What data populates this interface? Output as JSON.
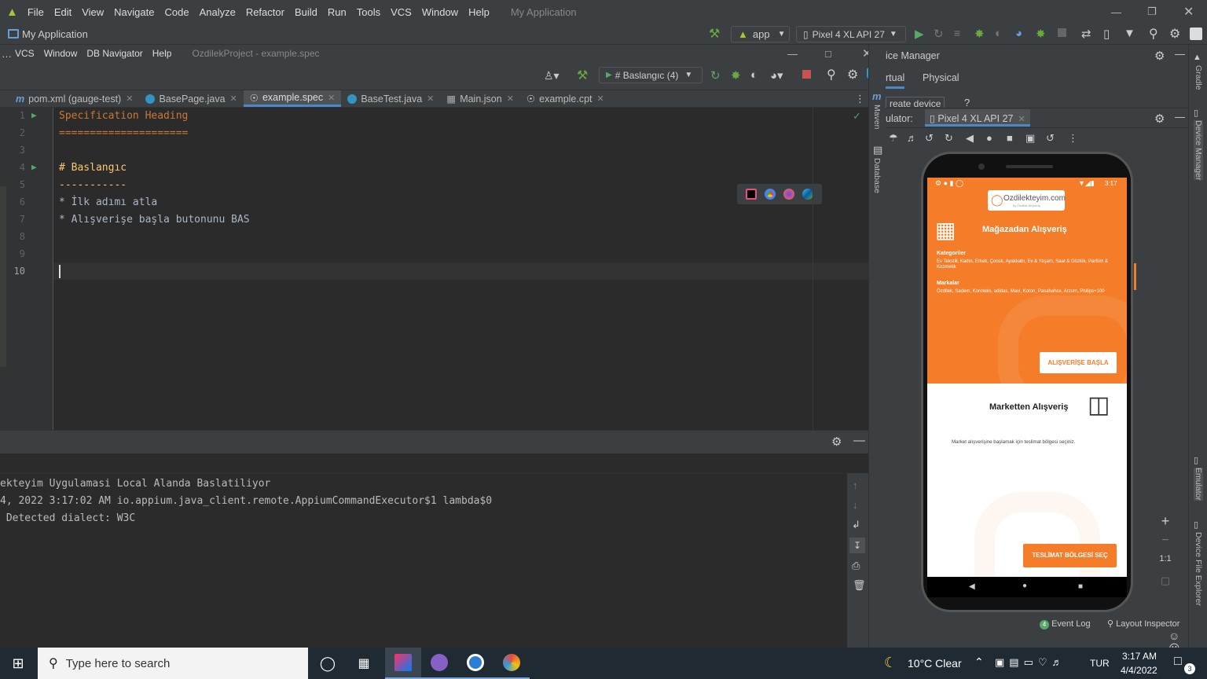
{
  "app": {
    "icon": "android-icon",
    "title": "My Application"
  },
  "menu1": [
    {
      "label": "File"
    },
    {
      "label": "Edit"
    },
    {
      "label": "View"
    },
    {
      "label": "Navigate"
    },
    {
      "label": "Code"
    },
    {
      "label": "Analyze"
    },
    {
      "label": "Refactor"
    },
    {
      "label": "Build"
    },
    {
      "label": "Run"
    },
    {
      "label": "Tools"
    },
    {
      "label": "VCS"
    },
    {
      "label": "Window"
    },
    {
      "label": "Help"
    }
  ],
  "project_label": "My Application",
  "toolbar1": {
    "run_config": "app",
    "device": "Pixel 4 XL API 27"
  },
  "menu2": [
    {
      "label": "VCS"
    },
    {
      "label": "Window"
    },
    {
      "label": "DB Navigator"
    },
    {
      "label": "Help"
    }
  ],
  "window2_title": "OzdilekProject - example.spec",
  "toolbar2": {
    "run_config": "# Baslangıc (4)"
  },
  "tabs": [
    {
      "label": "pom.xml (gauge-test)",
      "icon": "m"
    },
    {
      "label": "BasePage.java",
      "icon": "c"
    },
    {
      "label": "example.spec",
      "icon": "spec"
    },
    {
      "label": "BaseTest.java",
      "icon": "c"
    },
    {
      "label": "Main.json",
      "icon": "json"
    },
    {
      "label": "example.cpt",
      "icon": "spec"
    }
  ],
  "code_lines": [
    {
      "num": "1",
      "text": "Specification Heading",
      "color": "#cc7832"
    },
    {
      "num": "2",
      "text": "=====================",
      "color": "#cc7832"
    },
    {
      "num": "3",
      "text": "",
      "color": "#a9b7c6"
    },
    {
      "num": "4",
      "text": "# Baslangıc",
      "color": "#ffc66d"
    },
    {
      "num": "5",
      "text": "-----------",
      "color": "#ffc66d"
    },
    {
      "num": "6",
      "text": "* İlk adımı atla",
      "color": "#a9b7c6"
    },
    {
      "num": "7",
      "text": "* Alışverişe başla butonunu BAS",
      "color": "#a9b7c6"
    },
    {
      "num": "8",
      "text": "",
      "color": "#a9b7c6"
    },
    {
      "num": "9",
      "text": "",
      "color": "#a9b7c6"
    },
    {
      "num": "10",
      "text": "",
      "color": "#a9b7c6"
    }
  ],
  "console_lines": [
    "ekteyim Uygulamasi Local Alanda Baslatiliyor",
    "4, 2022 3:17:02 AM io.appium.java_client.remote.AppiumCommandExecutor$1 lambda$0",
    " Detected dialect: W3C"
  ],
  "right_strip": {
    "maven": "Maven",
    "database": "Database"
  },
  "far_right": {
    "gradle": "Gradle",
    "device_manager": "Device Manager",
    "emulator": "Emulator",
    "file_explorer": "Device File Explorer"
  },
  "device_manager": {
    "title": "ice Manager",
    "tab_virtual": "rtual",
    "tab_physical": "Physical",
    "create_device": "reate device",
    "help": "?",
    "emulator_label": "ulator:",
    "emulator_tab": "Pixel 4 XL API 27"
  },
  "zoom": {
    "plus": "+",
    "minus": "−",
    "one": "1:1"
  },
  "phone": {
    "time": "3:17",
    "logo": "Ozdilekteyim.com",
    "logo_sub": "by Özdilek Alışveriş",
    "store_title": "Mağazadan Alışveriş",
    "categories_label": "Kategoriler",
    "categories_text": "Ev Tekstili, Kadın, Erkek, Çocuk, Ayakkabı, Ev & Yaşam, Saat & Gözlük, Parfüm & Kozmetik",
    "brands_label": "Markalar",
    "brands_text": "Özdilek, Sadem, Koroteks, adidas, Mavi, Koton, Pasabahce, Arzum, Philips+100",
    "start_button": "ALIŞVERİŞE BAŞLA",
    "market_title": "Marketten Alışveriş",
    "market_text": "Market alışverişine başlamak için teslimat bölgesi seçiniz.",
    "delivery_button": "TESLİMAT BÖLGESİ SEÇ"
  },
  "status_bar": {
    "event_log": "Event Log",
    "layout_inspector": "Layout Inspector"
  },
  "taskbar": {
    "search_placeholder": "Type here to search",
    "weather": "10°C  Clear",
    "language": "TUR",
    "time": "3:17 AM",
    "date": "4/4/2022",
    "notifications": "3"
  }
}
